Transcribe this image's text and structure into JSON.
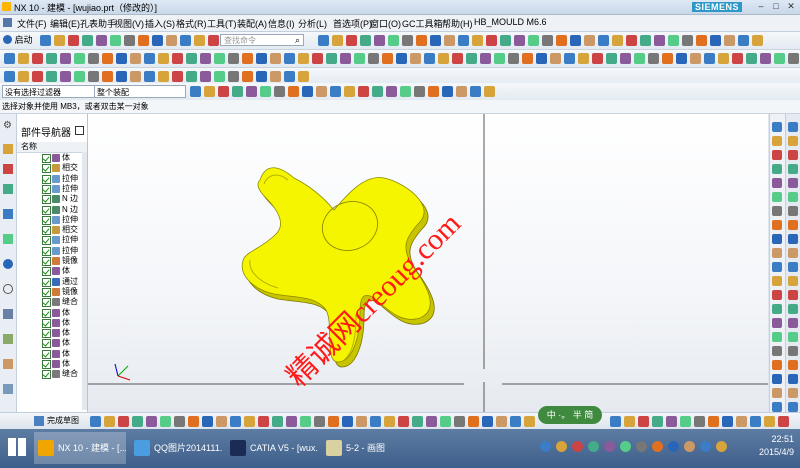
{
  "window": {
    "title": "NX 10 - 建模 - [wujiao.prt（修改的）]",
    "brand": "SIEMENS"
  },
  "menu": [
    "文件(F)",
    "编辑(E)",
    "孔表助手",
    "视图(V)",
    "插入(S)",
    "格式(R)",
    "工具(T)",
    "装配(A)",
    "信息(I)",
    "分析(L)",
    "首选项(P)",
    "窗口(O)",
    "GC工具箱",
    "帮助(H)",
    "HB_MOULD M6.6"
  ],
  "toolbar": {
    "start_label": "启动",
    "search_placeholder": "查找命令"
  },
  "filters": {
    "type_filter": "没有选择过滤器",
    "assembly_filter": "整个装配"
  },
  "status_prompt": "选择对象并使用 MB3，或者双击某一对象",
  "navigator": {
    "title": "部件导航器",
    "column_name": "名称",
    "items": [
      "体",
      "相交",
      "拉伸",
      "拉伸",
      "N 边",
      "N 边",
      "拉伸",
      "相交",
      "拉伸",
      "拉伸",
      "镜像",
      "体",
      "通过",
      "镜像",
      "缝合",
      "体",
      "体",
      "体",
      "体",
      "体",
      "体",
      "缝合"
    ]
  },
  "watermark": "精诚网creoug.com",
  "bottom_toolbar": {
    "finish_sketch": "完成草图"
  },
  "ime": "中 ·。 半 简",
  "taskbar": {
    "items": [
      "NX 10 - 建模 - [...",
      "QQ图片2014111...",
      "CATIA V5 - [wux...",
      "5-2 - 画图"
    ],
    "time": "22:51",
    "date": "2015/4/9"
  },
  "colors": {
    "part": "#f5f500",
    "part_shade": "#c8c400",
    "watermark": "#ff1a1a",
    "viewport_bg": "#ffffff"
  }
}
